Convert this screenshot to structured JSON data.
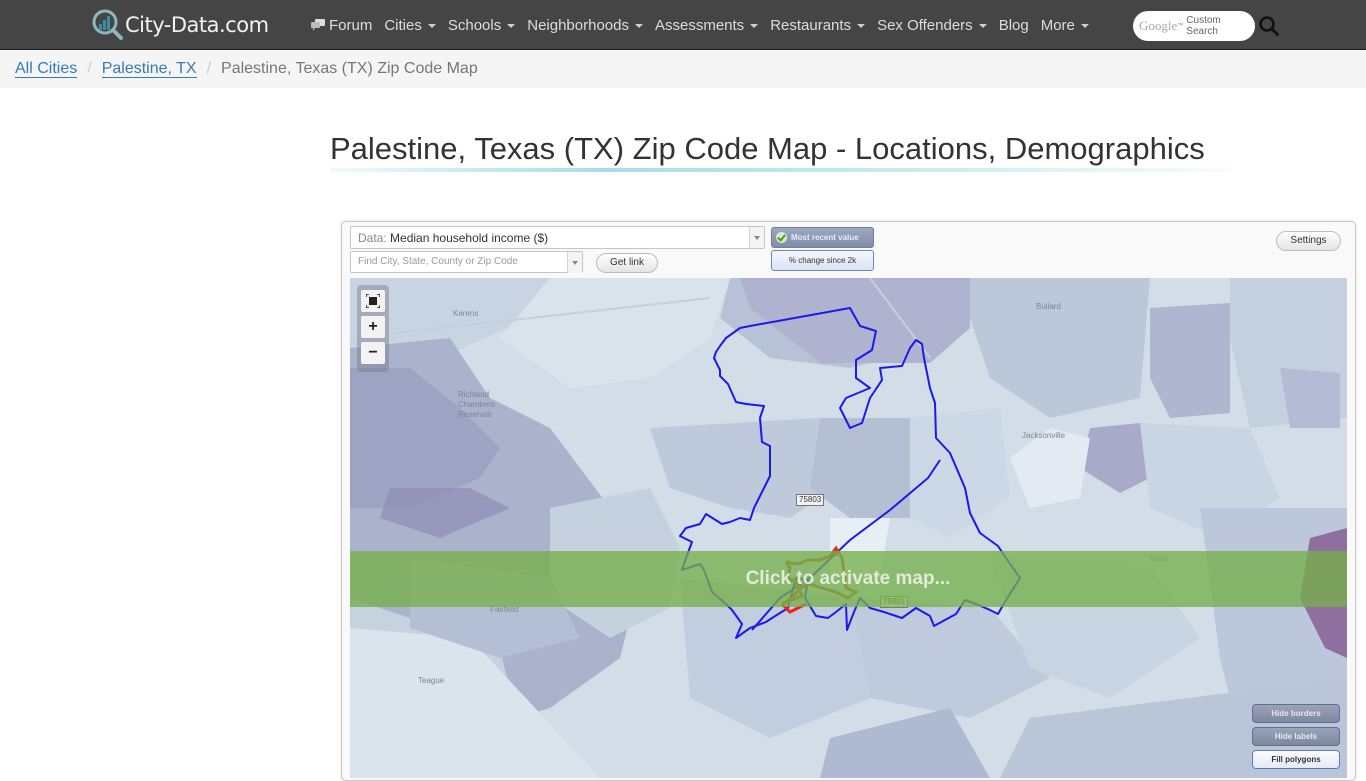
{
  "nav": {
    "logo_text": "City-Data.com",
    "items": [
      {
        "label": "Forum",
        "icon": "forum-icon",
        "dropdown": false
      },
      {
        "label": "Cities",
        "dropdown": true
      },
      {
        "label": "Schools",
        "dropdown": true
      },
      {
        "label": "Neighborhoods",
        "dropdown": true
      },
      {
        "label": "Assessments",
        "dropdown": true
      },
      {
        "label": "Restaurants",
        "dropdown": true
      },
      {
        "label": "Sex Offenders",
        "dropdown": true
      },
      {
        "label": "Blog",
        "dropdown": false
      },
      {
        "label": "More",
        "dropdown": true
      }
    ],
    "search": {
      "google_text": "Google",
      "tm": "™",
      "custom_search": "Custom Search",
      "icon": "search-icon"
    }
  },
  "breadcrumb": {
    "items": [
      {
        "label": "All Cities",
        "link": true
      },
      {
        "label": "Palestine, TX",
        "link": true
      },
      {
        "label": "Palestine, Texas (TX) Zip Code Map",
        "link": false
      }
    ],
    "separator": "/"
  },
  "page": {
    "title": "Palestine, Texas (TX) Zip Code Map - Locations, Demographics"
  },
  "map_controls": {
    "data_label": "Data:",
    "data_value": "Median household income ($)",
    "find_placeholder": "Find City, State, County or Zip Code",
    "get_link": "Get link",
    "most_recent": "Most recent value",
    "pct_change": "% change since 2k",
    "settings": "Settings"
  },
  "map": {
    "zoom_fit": "fit-extent-icon",
    "zoom_in": "+",
    "zoom_out": "−",
    "activate_text": "Click to activate map...",
    "zip_labels": [
      "75803",
      "75801"
    ],
    "place_labels": [
      "Kerens",
      "Richland Chambers Reservoir",
      "Bullard",
      "Jacksonville",
      "Fairfield",
      "Teague",
      "Rusk"
    ],
    "buttons": {
      "hide_borders": "Hide borders",
      "hide_labels": "Hide labels",
      "fill_polygons": "Fill polygons"
    },
    "colors": {
      "boundary": "#1a1aee",
      "city_outline": "#c0521a",
      "highlight": "#ff1a1a",
      "overlay": "#76b04a"
    }
  }
}
